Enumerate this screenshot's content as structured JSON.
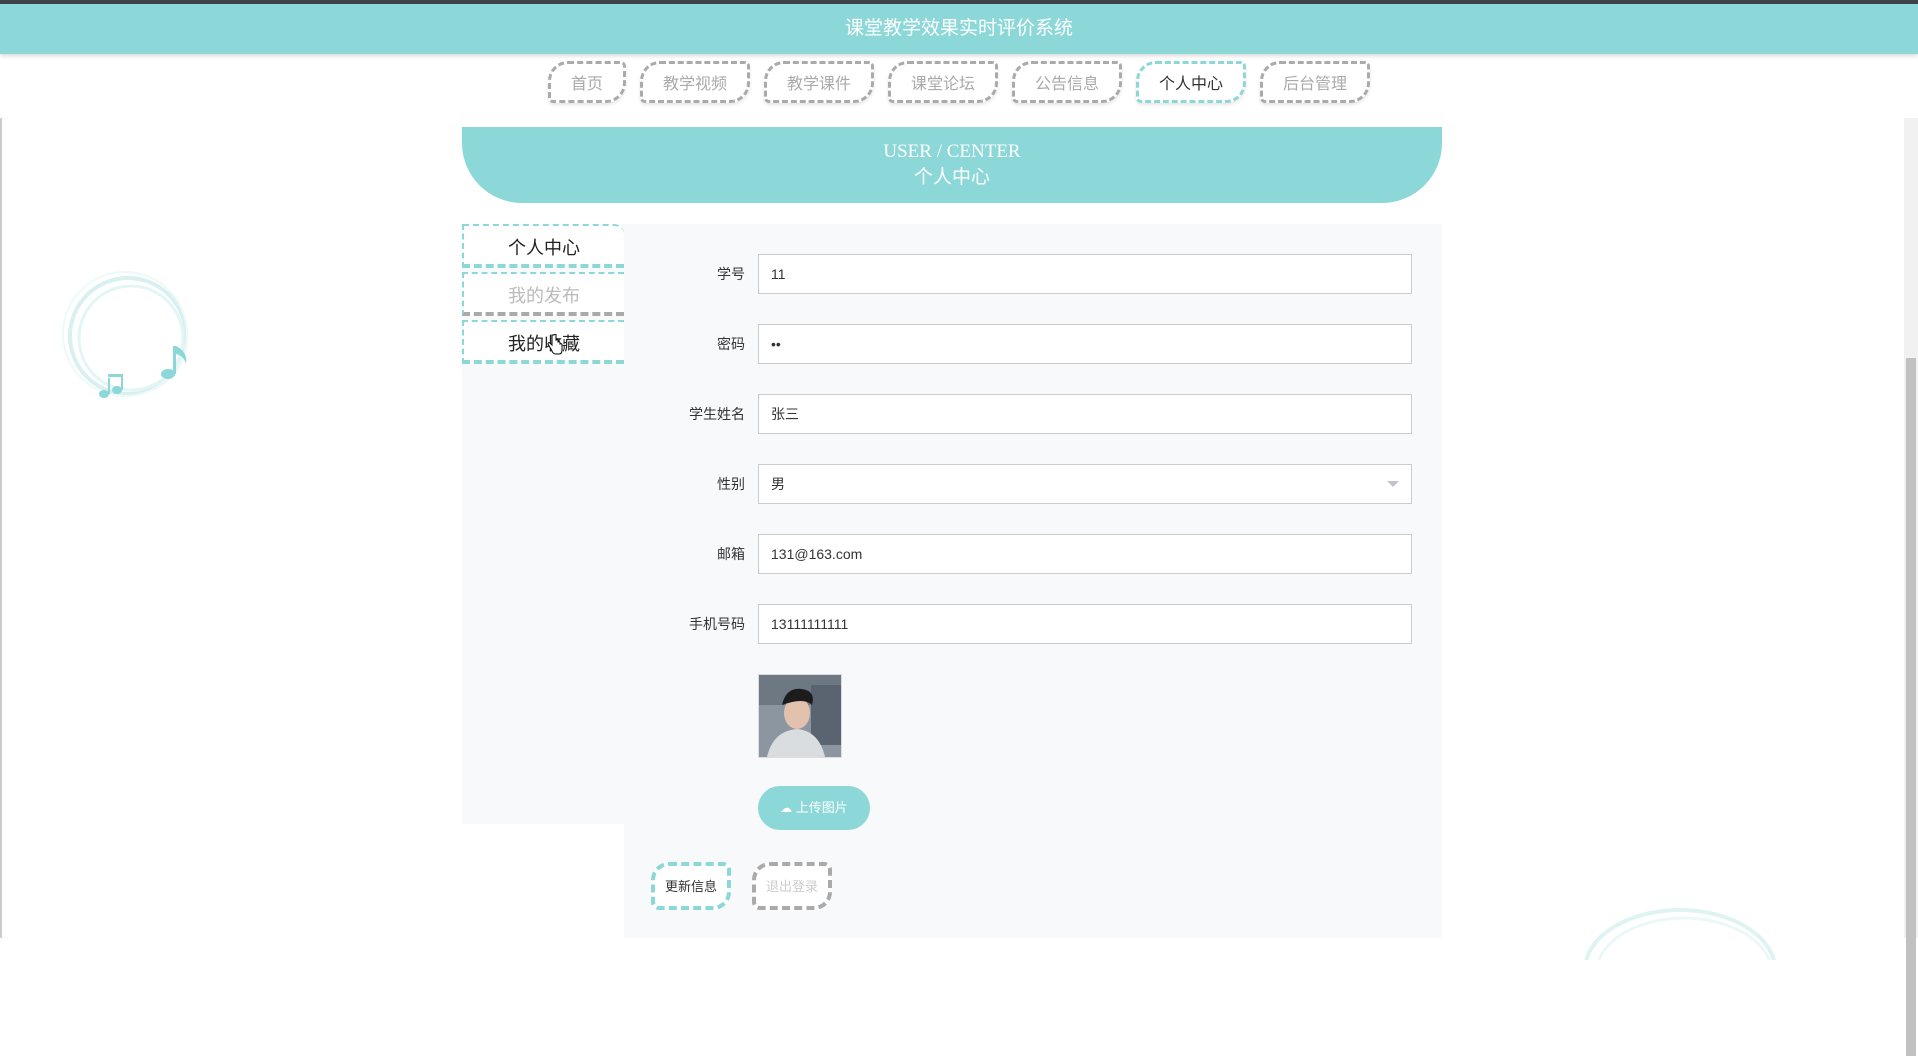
{
  "header": {
    "title": "课堂教学效果实时评价系统"
  },
  "nav": {
    "items": [
      "首页",
      "教学视频",
      "教学课件",
      "课堂论坛",
      "公告信息",
      "个人中心",
      "后台管理"
    ],
    "active": "个人中心"
  },
  "banner": {
    "en": "USER / CENTER",
    "cn": "个人中心"
  },
  "sidebar": {
    "items": [
      {
        "label": "个人中心",
        "state": "active"
      },
      {
        "label": "我的发布",
        "state": "inactive"
      },
      {
        "label": "我的收藏",
        "state": "hover"
      }
    ]
  },
  "form": {
    "student_id": {
      "label": "学号",
      "value": "11"
    },
    "password": {
      "label": "密码",
      "value": "••"
    },
    "name": {
      "label": "学生姓名",
      "value": "张三"
    },
    "gender": {
      "label": "性别",
      "value": "男"
    },
    "email": {
      "label": "邮箱",
      "value": "131@163.com"
    },
    "phone": {
      "label": "手机号码",
      "value": "13111111111"
    }
  },
  "upload": {
    "label": "上传图片"
  },
  "actions": {
    "update_label": "更新信息",
    "logout_label": "退出登录"
  },
  "colors": {
    "accent": "#8cd7d7",
    "muted": "#aaaaaa",
    "panel": "#f7f9fa"
  }
}
